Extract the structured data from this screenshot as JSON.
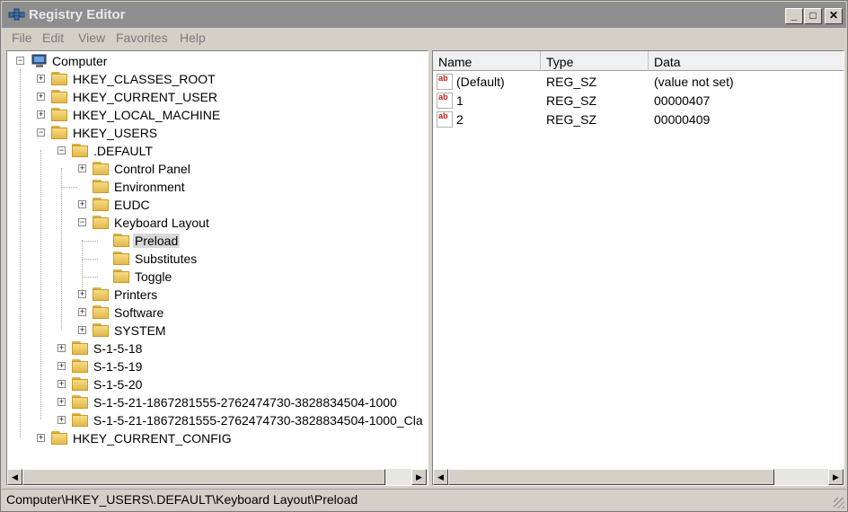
{
  "window": {
    "title": "Registry Editor"
  },
  "menu": [
    "File",
    "Edit",
    "View",
    "Favorites",
    "Help"
  ],
  "tree": [
    {
      "label": "Computer",
      "level": 0,
      "expander": "−",
      "icon": "computer-icon"
    },
    {
      "label": "HKEY_CLASSES_ROOT",
      "level": 1,
      "expander": "+"
    },
    {
      "label": "HKEY_CURRENT_USER",
      "level": 1,
      "expander": "+"
    },
    {
      "label": "HKEY_LOCAL_MACHINE",
      "level": 1,
      "expander": "+"
    },
    {
      "label": "HKEY_USERS",
      "level": 1,
      "expander": "−"
    },
    {
      "label": ".DEFAULT",
      "level": 2,
      "expander": "−"
    },
    {
      "label": "Control Panel",
      "level": 3,
      "expander": "+"
    },
    {
      "label": "Environment",
      "level": 3,
      "expander": ""
    },
    {
      "label": "EUDC",
      "level": 3,
      "expander": "+"
    },
    {
      "label": "Keyboard Layout",
      "level": 3,
      "expander": "−"
    },
    {
      "label": "Preload",
      "level": 4,
      "expander": "",
      "selected": true
    },
    {
      "label": "Substitutes",
      "level": 4,
      "expander": ""
    },
    {
      "label": "Toggle",
      "level": 4,
      "expander": ""
    },
    {
      "label": "Printers",
      "level": 3,
      "expander": "+"
    },
    {
      "label": "Software",
      "level": 3,
      "expander": "+"
    },
    {
      "label": "SYSTEM",
      "level": 3,
      "expander": "+"
    },
    {
      "label": "S-1-5-18",
      "level": 2,
      "expander": "+"
    },
    {
      "label": "S-1-5-19",
      "level": 2,
      "expander": "+"
    },
    {
      "label": "S-1-5-20",
      "level": 2,
      "expander": "+"
    },
    {
      "label": "S-1-5-21-1867281555-2762474730-3828834504-1000",
      "level": 2,
      "expander": "+"
    },
    {
      "label": "S-1-5-21-1867281555-2762474730-3828834504-1000_Cla",
      "level": 2,
      "expander": "+"
    },
    {
      "label": "HKEY_CURRENT_CONFIG",
      "level": 1,
      "expander": "+"
    }
  ],
  "list": {
    "columns": [
      "Name",
      "Type",
      "Data"
    ],
    "rows": [
      {
        "name": "(Default)",
        "type": "REG_SZ",
        "data": "(value not set)",
        "icon": "ab"
      },
      {
        "name": "1",
        "type": "REG_SZ",
        "data": "00000407",
        "icon": "ab"
      },
      {
        "name": "2",
        "type": "REG_SZ",
        "data": "00000409",
        "icon": "ab"
      }
    ]
  },
  "status": {
    "path": "Computer\\HKEY_USERS\\.DEFAULT\\Keyboard Layout\\Preload"
  },
  "colors": {
    "titlebar": "#8e8e8e",
    "selection": "#d8d8d8",
    "folder": "#f6dc86"
  }
}
